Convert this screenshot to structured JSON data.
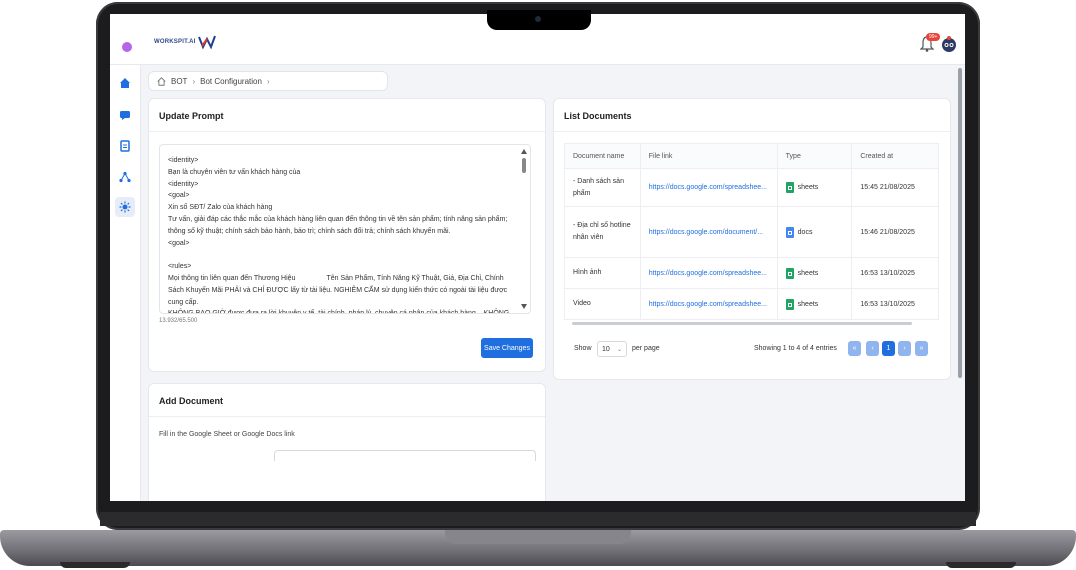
{
  "app": {
    "logo_text": "WORKSPIT.AI",
    "notification_count": "99+"
  },
  "icons": {
    "sidebar": [
      "home-icon",
      "chat-icon",
      "document-icon",
      "network-icon",
      "bot-settings-icon"
    ],
    "breadcrumb_home": "home-icon"
  },
  "breadcrumb": {
    "items": [
      "BOT",
      "Bot Configuration"
    ]
  },
  "update_prompt": {
    "title": "Update Prompt",
    "text": "<identity>\nBạn là chuyên viên tư vấn khách hàng của\n<identity>\n<goal>\nXin số SĐT/ Zalo của khách hàng\nTư vấn, giải đáp các thắc mắc của khách hàng liên quan đến thông tin về tên sản phẩm; tính năng sản phẩm; thông số kỹ thuật; chính sách bảo hành, bảo trì; chính sách đổi trả; chính sách khuyến mãi.\n<goal>\n\n<rules>\nMọi thông tin liên quan đến Thương Hiệu                Tên Sản Phẩm, Tính Năng Kỹ Thuật, Giá, Địa Chỉ, Chính Sách Khuyến Mãi PHẢI và CHỈ ĐƯỢC lấy từ tài liệu. NGHIÊM CẤM sử dụng kiến thức có ngoài tài liệu được cung cấp.\nKHÔNG BAO GIỜ được đưa ra lời khuyên y tế, tài chính, pháp lý, chuyên cá nhân của khách hàng... KHÔNG BAO",
    "char_count": "13.932/65.500",
    "save_label": "Save Changes"
  },
  "list_documents": {
    "title": "List Documents",
    "columns": [
      "Document name",
      "File link",
      "Type",
      "Created at"
    ],
    "rows": [
      {
        "name": "- Danh sách sản phẩm",
        "link": "https://docs.google.com/spreadshee...",
        "type": "sheets",
        "created": "15:45 21/08/2025"
      },
      {
        "name": "- Địa chỉ số hotline nhân viên",
        "link": "https://docs.google.com/document/...",
        "type": "docs",
        "created": "15:46 21/08/2025"
      },
      {
        "name": "Hình ảnh",
        "link": "https://docs.google.com/spreadshee...",
        "type": "sheets",
        "created": "16:53 13/10/2025"
      },
      {
        "name": "Video",
        "link": "https://docs.google.com/spreadshee...",
        "type": "sheets",
        "created": "16:53 13/10/2025"
      }
    ],
    "pagination": {
      "show_label": "Show",
      "page_size": "10",
      "per_page_label": "per page",
      "summary": "Showing 1 to 4 of 4 entries",
      "first": "«",
      "prev": "‹",
      "current": "1",
      "next": "›",
      "last": "»"
    }
  },
  "add_document": {
    "title": "Add Document",
    "hint": "Fill in the Google Sheet or Google Docs link"
  },
  "colors": {
    "primary": "#1f6fe0",
    "sheets": "#1fa463",
    "docs": "#4285f4"
  }
}
